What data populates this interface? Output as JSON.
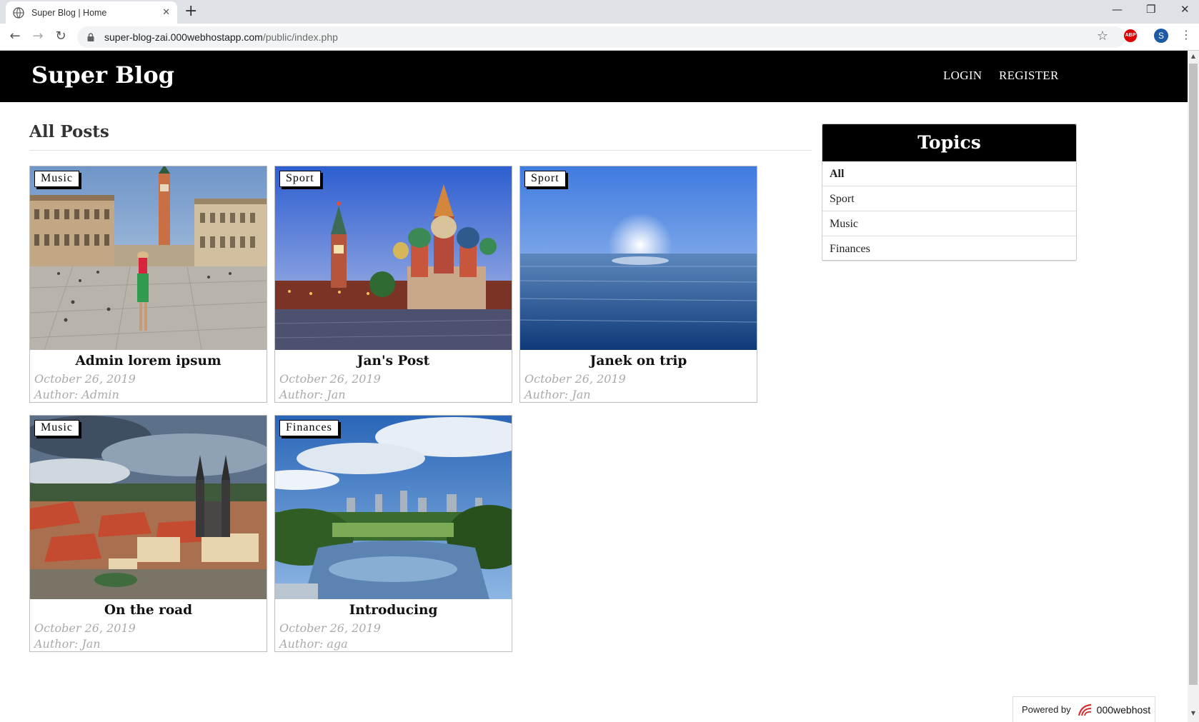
{
  "browser": {
    "tab_title": "Super Blog | Home",
    "tab_close": "✕",
    "new_tab": "+",
    "window": {
      "minimize": "—",
      "restore": "❐",
      "close": "✕"
    },
    "nav": {
      "back": "←",
      "forward": "→",
      "reload": "↻"
    },
    "url_host": "super-blog-zai.000webhostapp.com",
    "url_path": "/public/index.php",
    "bookmark_star": "☆",
    "extension_label": "ABP",
    "profile_initial": "S",
    "menu": "⋮",
    "scroll_up": "▲",
    "scroll_down": "▼"
  },
  "header": {
    "logo": "Super Blog",
    "nav": {
      "login": "LOGIN",
      "register": "REGISTER"
    }
  },
  "main": {
    "title": "All Posts",
    "posts": [
      {
        "topic": "Music",
        "title": "Admin lorem ipsum",
        "date": "October 26, 2019",
        "author": "Author: Admin",
        "image": "venice-square-photo"
      },
      {
        "topic": "Sport",
        "title": "Jan's Post",
        "date": "October 26, 2019",
        "author": "Author: Jan",
        "image": "moscow-cathedral-photo"
      },
      {
        "topic": "Sport",
        "title": "Janek on trip",
        "date": "October 26, 2019",
        "author": "Author: Jan",
        "image": "sea-sunset-photo"
      },
      {
        "topic": "Music",
        "title": "On the road",
        "date": "October 26, 2019",
        "author": "Author: Jan",
        "image": "prague-old-town-photo"
      },
      {
        "topic": "Finances",
        "title": "Introducing",
        "date": "October 26, 2019",
        "author": "Author: aga",
        "image": "central-park-lake-photo"
      }
    ]
  },
  "sidebar": {
    "title": "Topics",
    "items": [
      {
        "label": "All",
        "active": true
      },
      {
        "label": "Sport",
        "active": false
      },
      {
        "label": "Music",
        "active": false
      },
      {
        "label": "Finances",
        "active": false
      }
    ]
  },
  "footer": {
    "powered_label": "Powered by",
    "brand": "000webhost"
  },
  "colors": {
    "header_bg": "#000000",
    "date_text": "#aaaaaa",
    "brand_red": "#d32f2f"
  }
}
